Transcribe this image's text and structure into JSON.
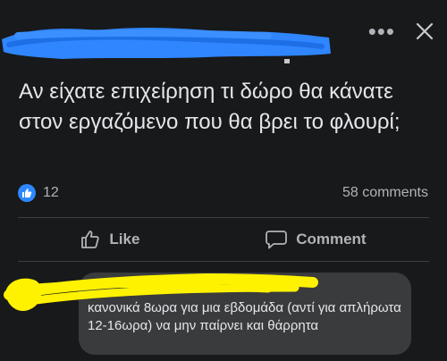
{
  "post": {
    "text": "Αν είχατε επιχείρηση τι δώρο θα κάνατε στον εργαζόμενο που θα βρει το φλουρί;",
    "reactions_count": "12",
    "comments_label": "58 comments"
  },
  "header": {
    "more_glyph": "•••"
  },
  "actions": {
    "like_label": "Like",
    "comment_label": "Comment"
  },
  "comment": {
    "text": "κανονικά 8ωρα για μια εβδομάδα (αντί για απλήρωτα 12-16ωρα) να μην παίρνει και θάρρητα"
  },
  "colors": {
    "background": "#18191a",
    "like_blue": "#2d88ff",
    "redaction_blue": "#2f86ff",
    "redaction_yellow": "#fff200"
  },
  "icons": {
    "more": "more-icon",
    "close": "close-icon",
    "like_badge": "thumbs-up-icon",
    "like_action": "thumbs-up-outline-icon",
    "comment_action": "speech-bubble-icon"
  }
}
